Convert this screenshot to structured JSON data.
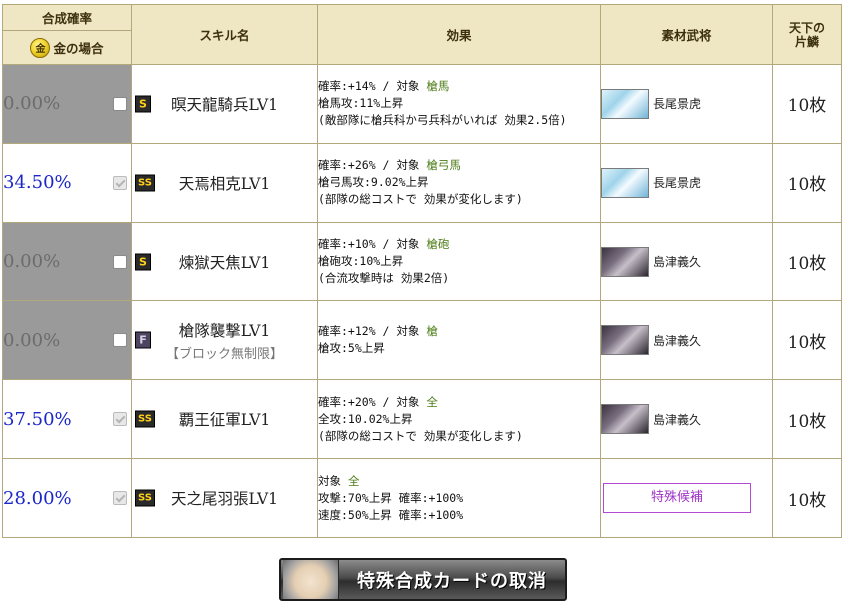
{
  "header": {
    "rate_title": "合成確率",
    "rate_subtitle": "金の場合",
    "coin_icon_glyph": "金",
    "skill_name": "スキル名",
    "effect": "効果",
    "material": "素材武将",
    "tenka_line1": "天下の",
    "tenka_line2": "片鱗"
  },
  "rows": [
    {
      "rate": "0.00%",
      "checked": false,
      "rank": "S",
      "skill": "暝天龍騎兵LV1",
      "note": "",
      "effect_line1_a": "確率:+14%  /  対象",
      "effect_target": "槍馬",
      "effect_line2": "槍馬攻:11%上昇",
      "effect_line3": "(敵部隊に槍兵科か弓兵科がいれば 効果2.5倍)",
      "general": "長尾景虎",
      "portrait": "kenshin-portrait-icon",
      "pieces": "10枚"
    },
    {
      "rate": "34.50%",
      "checked": true,
      "rank": "SS",
      "skill": "天焉相克LV1",
      "note": "",
      "effect_line1_a": "確率:+26%  /  対象",
      "effect_target": "槍弓馬",
      "effect_line2": "槍弓馬攻:9.02%上昇",
      "effect_line3": "(部隊の総コストで 効果が変化します)",
      "general": "長尾景虎",
      "portrait": "kenshin-portrait-icon",
      "pieces": "10枚"
    },
    {
      "rate": "0.00%",
      "checked": false,
      "rank": "S",
      "skill": "煉獄天焦LV1",
      "note": "",
      "effect_line1_a": "確率:+10%  /  対象",
      "effect_target": "槍砲",
      "effect_line2": "槍砲攻:10%上昇",
      "effect_line3": "(合流攻撃時は 効果2倍)",
      "general": "島津義久",
      "portrait": "shimazu-portrait-icon",
      "pieces": "10枚"
    },
    {
      "rate": "0.00%",
      "checked": false,
      "rank": "F",
      "skill": "槍隊襲撃LV1",
      "note": "【ブロック無制限】",
      "effect_line1_a": "確率:+12%  /  対象",
      "effect_target": "槍",
      "effect_line2": "槍攻:5%上昇",
      "effect_line3": "",
      "general": "島津義久",
      "portrait": "shimazu-portrait-icon",
      "pieces": "10枚"
    },
    {
      "rate": "37.50%",
      "checked": true,
      "rank": "SS",
      "skill": "覇王征軍LV1",
      "note": "",
      "effect_line1_a": "確率:+20%  /  対象",
      "effect_target": "全",
      "effect_line2": "全攻:10.02%上昇",
      "effect_line3": "(部隊の総コストで 効果が変化します)",
      "general": "島津義久",
      "portrait": "shimazu-portrait-icon",
      "pieces": "10枚"
    },
    {
      "rate": "28.00%",
      "checked": true,
      "rank": "SS",
      "skill": "天之尾羽張LV1",
      "note": "",
      "effect_line1_a": "対象",
      "effect_target": "全",
      "effect_line2": "攻撃:70%上昇  確率:+100%",
      "effect_line3": "速度:50%上昇  確率:+100%",
      "special_label": "特殊候補",
      "pieces": "10枚"
    }
  ],
  "footer": {
    "cancel_label": "特殊合成カードの取消"
  },
  "colors": {
    "active_rate": "#1b27c8",
    "inactive_bg": "#9a9a9a",
    "target_green": "#4e7d18",
    "header_bg": "#efe6c3",
    "special_purple": "#a035c8"
  }
}
